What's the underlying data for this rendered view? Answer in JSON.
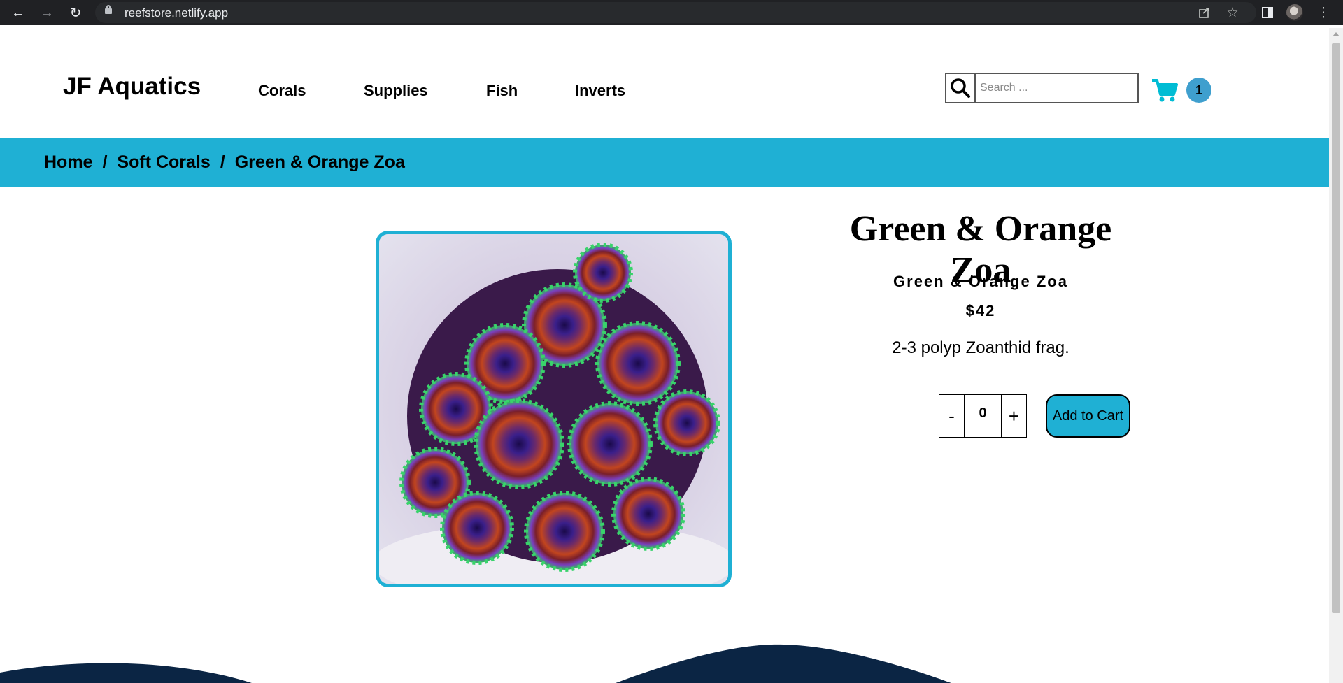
{
  "browser": {
    "url": "reefstore.netlify.app",
    "icons": {
      "back": "back-arrow-icon",
      "forward": "forward-arrow-icon",
      "reload": "reload-icon",
      "lock": "lock-icon",
      "share": "share-icon",
      "bookmark": "star-icon",
      "sidepanel": "side-panel-icon",
      "profile": "avatar",
      "menu": "kebab-menu-icon"
    }
  },
  "header": {
    "logo": "JF Aquatics",
    "nav": [
      "Corals",
      "Supplies",
      "Fish",
      "Inverts"
    ],
    "search_placeholder": "Search ...",
    "cart_count": "1"
  },
  "breadcrumb": {
    "items": [
      "Home",
      "Soft Corals",
      "Green & Orange Zoa"
    ],
    "separator": "/"
  },
  "product": {
    "title": "Green & Orange Zoa",
    "subtitle": "Green & Orange Zoa",
    "price": "$42",
    "description": "2-3 polyp Zoanthid frag.",
    "quantity": "0",
    "decrement_label": "-",
    "increment_label": "+",
    "add_to_cart_label": "Add to Cart"
  },
  "colors": {
    "accent": "#1fb0d4",
    "cart_icon": "#00bcd4",
    "cart_badge": "#3f9fce",
    "footer_wave": "#0b2544"
  }
}
